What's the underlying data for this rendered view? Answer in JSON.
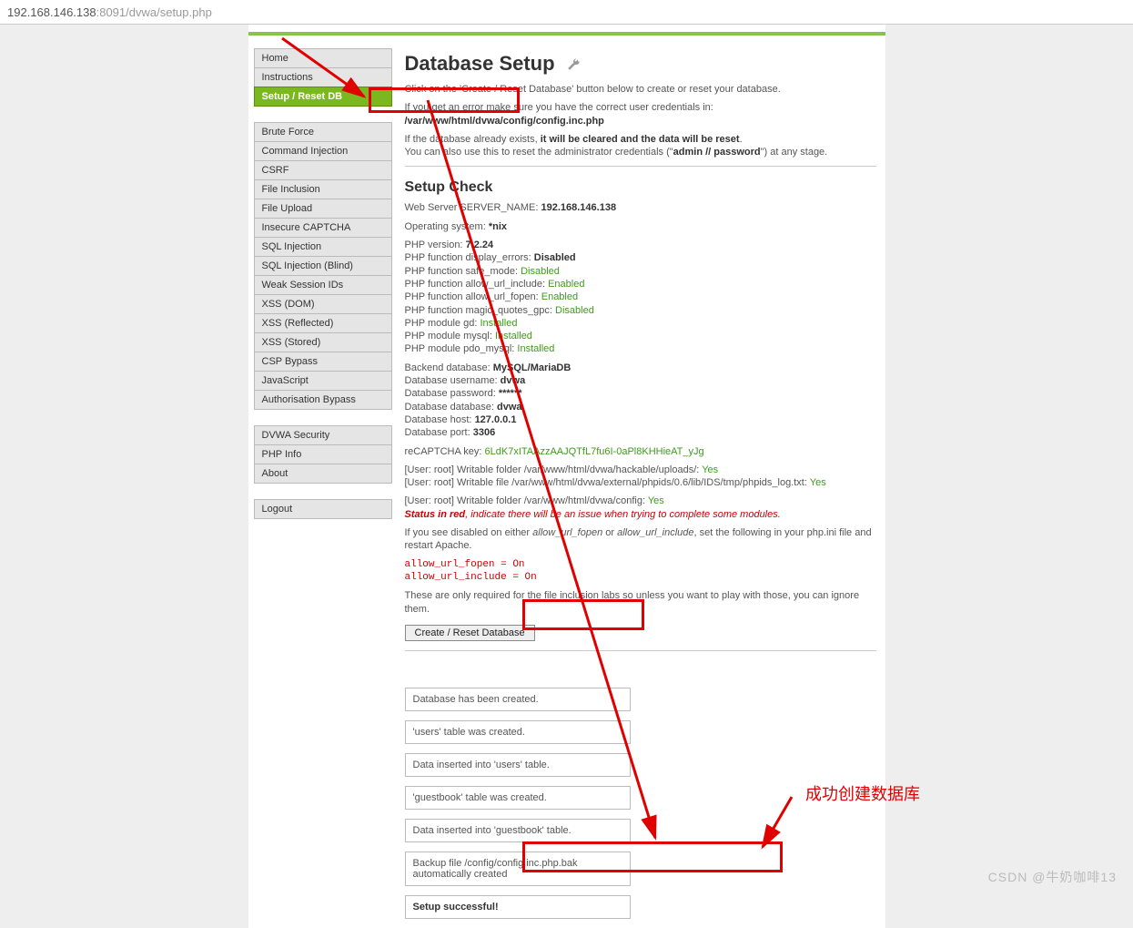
{
  "url": {
    "host": "192.168.146.138",
    "port_path": ":8091/dvwa/setup.php"
  },
  "menu": {
    "g1": [
      {
        "label": "Home",
        "active": false
      },
      {
        "label": "Instructions",
        "active": false
      },
      {
        "label": "Setup / Reset DB",
        "active": true
      }
    ],
    "g2": [
      {
        "label": "Brute Force"
      },
      {
        "label": "Command Injection"
      },
      {
        "label": "CSRF"
      },
      {
        "label": "File Inclusion"
      },
      {
        "label": "File Upload"
      },
      {
        "label": "Insecure CAPTCHA"
      },
      {
        "label": "SQL Injection"
      },
      {
        "label": "SQL Injection (Blind)"
      },
      {
        "label": "Weak Session IDs"
      },
      {
        "label": "XSS (DOM)"
      },
      {
        "label": "XSS (Reflected)"
      },
      {
        "label": "XSS (Stored)"
      },
      {
        "label": "CSP Bypass"
      },
      {
        "label": "JavaScript"
      },
      {
        "label": "Authorisation Bypass"
      }
    ],
    "g3": [
      {
        "label": "DVWA Security"
      },
      {
        "label": "PHP Info"
      },
      {
        "label": "About"
      }
    ],
    "g4": [
      {
        "label": "Logout"
      }
    ]
  },
  "heading": "Database Setup",
  "intro": {
    "line1": "Click on the 'Create / Reset Database' button below to create or reset your database.",
    "line2": "If you get an error make sure you have the correct user credentials in:",
    "config_path": "/var/www/html/dvwa/config/config.inc.php",
    "exists_pre": "If the database already exists, ",
    "exists_bold": "it will be cleared and the data will be reset",
    "exists_post": ".",
    "reset_admin_pre": "You can also use this to reset the administrator credentials (\"",
    "reset_admin_creds": "admin // password",
    "reset_admin_post": "\") at any stage."
  },
  "setup_check_heading": "Setup Check",
  "check": {
    "server_name_label": "Web Server SERVER_NAME: ",
    "server_name": "192.168.146.138",
    "os_label": "Operating system: ",
    "os": "*nix",
    "php_version_label": "PHP version: ",
    "php_version": "7.2.24",
    "display_errors_label": "PHP function display_errors: ",
    "display_errors": "Disabled",
    "safe_mode_label": "PHP function safe_mode: ",
    "safe_mode": "Disabled",
    "allow_url_include_label": "PHP function allow_url_include: ",
    "allow_url_include": "Enabled",
    "allow_url_fopen_label": "PHP function allow_url_fopen: ",
    "allow_url_fopen": "Enabled",
    "magic_quotes_label": "PHP function magic_quotes_gpc: ",
    "magic_quotes": "Disabled",
    "module_gd_label": "PHP module gd: ",
    "module_gd": "Installed",
    "module_mysql_label": "PHP module mysql: ",
    "module_mysql": "Installed",
    "module_pdo_label": "PHP module pdo_mysql: ",
    "module_pdo": "Installed",
    "backend_label": "Backend database: ",
    "backend": "MySQL/MariaDB",
    "db_user_label": "Database username: ",
    "db_user": "dvwa",
    "db_pass_label": "Database password: ",
    "db_pass": "******",
    "db_name_label": "Database database: ",
    "db_name": "dvwa",
    "db_host_label": "Database host: ",
    "db_host": "127.0.0.1",
    "db_port_label": "Database port: ",
    "db_port": "3306",
    "recaptcha_label": "reCAPTCHA key: ",
    "recaptcha": "6LdK7xITAAzzAAJQTfL7fu6I-0aPl8KHHieAT_yJg",
    "writable_uploads_label": "[User: root] Writable folder /var/www/html/dvwa/hackable/uploads/: ",
    "writable_uploads": "Yes",
    "writable_phpids_label": "[User: root] Writable file /var/www/html/dvwa/external/phpids/0.6/lib/IDS/tmp/phpids_log.txt: ",
    "writable_phpids": "Yes",
    "writable_config_label": "[User: root] Writable folder /var/www/html/dvwa/config: ",
    "writable_config": "Yes",
    "status_red_label": "Status in red",
    "status_red_text": ", indicate there will be an issue when trying to complete some modules.",
    "disabled_note_pre": "If you see disabled on either ",
    "disabled_note_f1": "allow_url_fopen",
    "disabled_note_mid": " or ",
    "disabled_note_f2": "allow_url_include",
    "disabled_note_post": ", set the following in your php.ini file and restart Apache.",
    "ini1": "allow_url_fopen = On",
    "ini2": "allow_url_include = On",
    "required_note": "These are only required for the file inclusion labs so unless you want to play with those, you can ignore them."
  },
  "button_label": "Create / Reset Database",
  "status_messages": [
    "Database has been created.",
    "'users' table was created.",
    "Data inserted into 'users' table.",
    "'guestbook' table was created.",
    "Data inserted into 'guestbook' table.",
    "Backup file /config/config.inc.php.bak automatically created"
  ],
  "status_success": "Setup successful!",
  "annotation_label": "成功创建数据库",
  "watermark": "CSDN @牛奶咖啡13"
}
